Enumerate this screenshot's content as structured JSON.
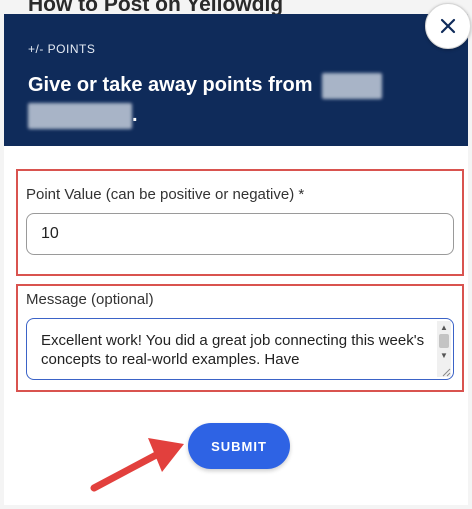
{
  "background": {
    "page_title": "How to Post on Yellowdig"
  },
  "modal": {
    "kicker": "+/- POINTS",
    "heading_text": "Give or take away points from",
    "heading_end": ".",
    "close_icon": "close-icon",
    "point_field": {
      "label": "Point Value (can be positive or negative)",
      "required_mark": "*",
      "value": "10"
    },
    "message_field": {
      "label": "Message (optional)",
      "value": "Excellent work! You did a great job connecting this week's concepts to real-world examples. Have"
    },
    "submit_label": "SUBMIT"
  },
  "colors": {
    "header_bg": "#0f2b5a",
    "accent": "#2e63e4",
    "highlight_box": "#d9534f",
    "annotation_arrow": "#e2403d"
  }
}
